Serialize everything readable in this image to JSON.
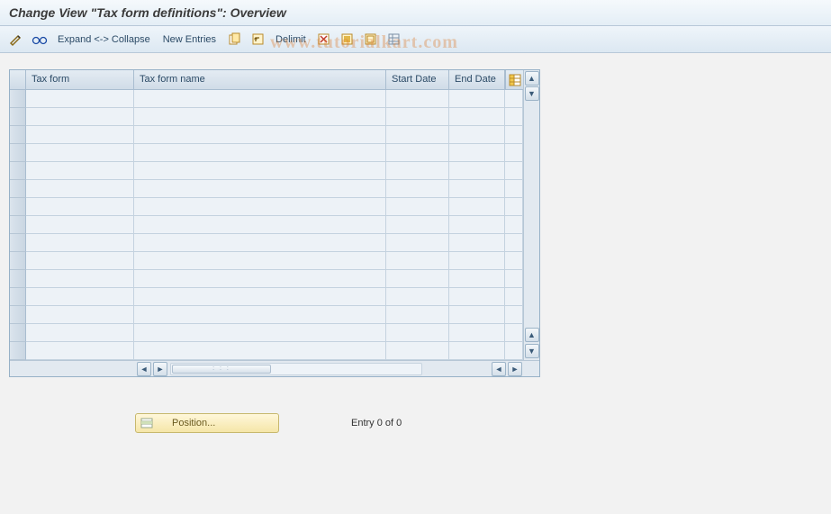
{
  "title": "Change View \"Tax form definitions\": Overview",
  "toolbar": {
    "expand_collapse": "Expand <-> Collapse",
    "new_entries": "New Entries",
    "delimit": "Delimit"
  },
  "columns": {
    "tax_form": "Tax form",
    "tax_form_name": "Tax form name",
    "start_date": "Start Date",
    "end_date": "End Date"
  },
  "rows": [
    {},
    {},
    {},
    {},
    {},
    {},
    {},
    {},
    {},
    {},
    {},
    {},
    {},
    {},
    {}
  ],
  "position_button": "Position...",
  "entry_status": "Entry 0 of 0",
  "watermark": "www.tutorialkart.com"
}
